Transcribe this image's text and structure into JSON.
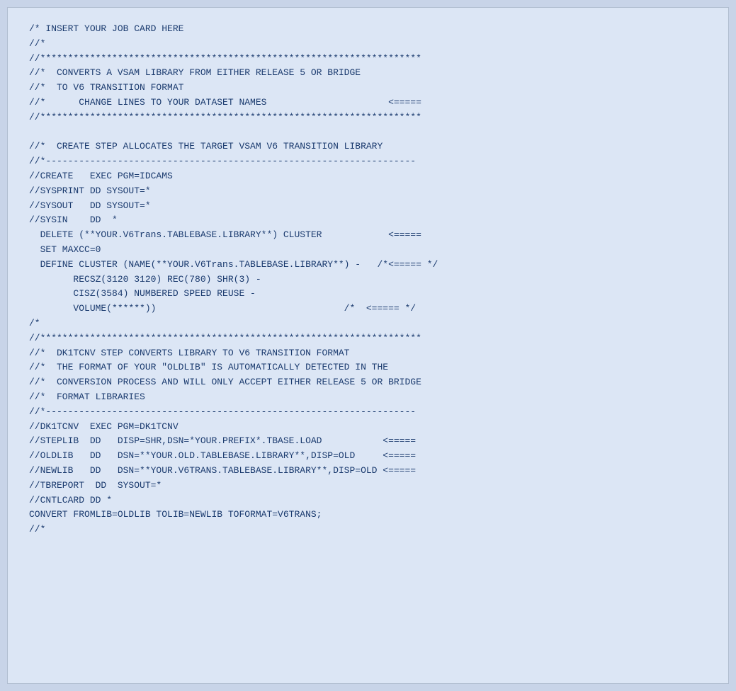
{
  "code": {
    "lines": [
      "/* INSERT YOUR JOB CARD HERE",
      "//*",
      "//*********************************************************************",
      "//*  CONVERTS A VSAM LIBRARY FROM EITHER RELEASE 5 OR BRIDGE",
      "//*  TO V6 TRANSITION FORMAT",
      "//*      CHANGE LINES TO YOUR DATASET NAMES                      <=====",
      "//*********************************************************************",
      "",
      "//*  CREATE STEP ALLOCATES THE TARGET VSAM V6 TRANSITION LIBRARY",
      "//*-------------------------------------------------------------------",
      "//CREATE   EXEC PGM=IDCAMS",
      "//SYSPRINT DD SYSOUT=*",
      "//SYSOUT   DD SYSOUT=*",
      "//SYSIN    DD  *",
      "  DELETE (**YOUR.V6Trans.TABLEBASE.LIBRARY**) CLUSTER            <=====",
      "  SET MAXCC=0",
      "  DEFINE CLUSTER (NAME(**YOUR.V6Trans.TABLEBASE.LIBRARY**) -   /*<===== */",
      "        RECSZ(3120 3120) REC(780) SHR(3) -",
      "        CISZ(3584) NUMBERED SPEED REUSE -",
      "        VOLUME(******))                                  /*  <===== */",
      "/*",
      "//*********************************************************************",
      "//*  DK1TCNV STEP CONVERTS LIBRARY TO V6 TRANSITION FORMAT",
      "//*  THE FORMAT OF YOUR \"OLDLIB\" IS AUTOMATICALLY DETECTED IN THE",
      "//*  CONVERSION PROCESS AND WILL ONLY ACCEPT EITHER RELEASE 5 OR BRIDGE",
      "//*  FORMAT LIBRARIES",
      "//*-------------------------------------------------------------------",
      "//DK1TCNV  EXEC PGM=DK1TCNV",
      "//STEPLIB  DD   DISP=SHR,DSN=*YOUR.PREFIX*.TBASE.LOAD           <=====",
      "//OLDLIB   DD   DSN=**YOUR.OLD.TABLEBASE.LIBRARY**,DISP=OLD     <=====",
      "//NEWLIB   DD   DSN=**YOUR.V6TRANS.TABLEBASE.LIBRARY**,DISP=OLD <=====",
      "//TBREPORT  DD  SYSOUT=*",
      "//CNTLCARD DD *",
      "CONVERT FROMLIB=OLDLIB TOLIB=NEWLIB TOFORMAT=V6TRANS;",
      "//*"
    ]
  }
}
